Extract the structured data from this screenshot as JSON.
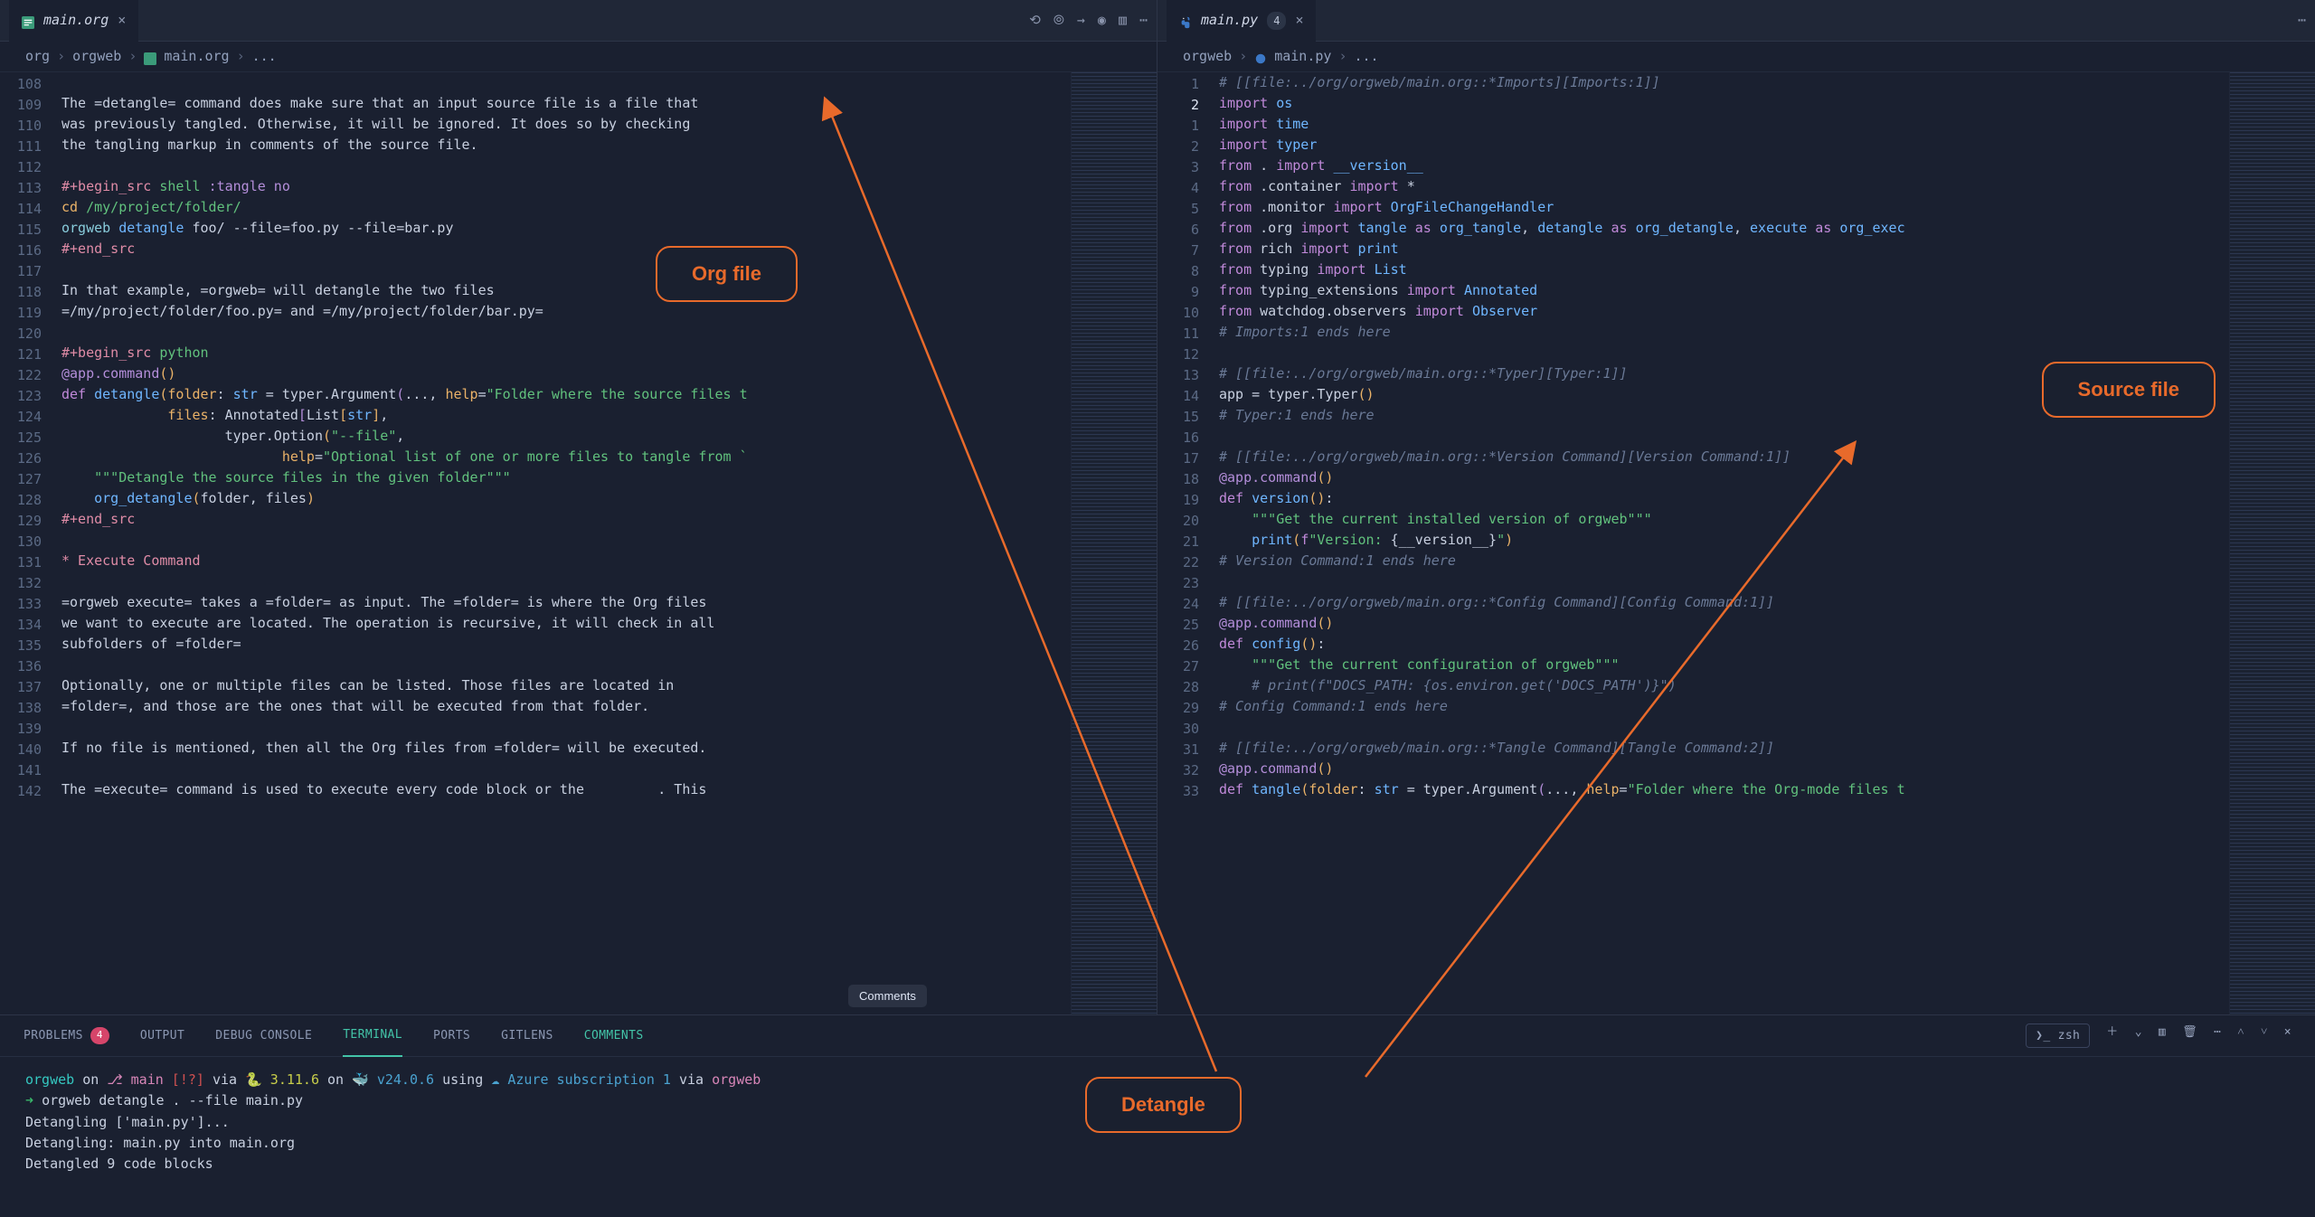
{
  "left": {
    "tabName": "main.org",
    "crumbs": [
      "org",
      "orgweb",
      "main.org",
      "..."
    ],
    "start": 108,
    "code": [
      "",
      "The =detangle= command does make sure that an input source file is a file that",
      "was previously tangled. Otherwise, it will be ignored. It does so by checking",
      "the tangling markup in comments of the source file.",
      "",
      "<dr>#+begin_src</dr> <st>shell</st> <hl>:tangle no</hl>",
      "<yl>cd</yl> <st>/my/project/folder/</st>",
      "<op>orgweb</op> <fn>detangle</fn> foo/ --file=foo.py --file=bar.py",
      "<dr>#+end_src</dr>",
      "",
      "In that example, =orgweb= will detangle the two files",
      "=/my/project/folder/foo.py= and =/my/project/folder/bar.py=",
      "",
      "<dr>#+begin_src</dr> <st>python</st>",
      "<hl>@app.command</hl><yl>()</yl>",
      "<kw>def</kw> <fn>detangle</fn><yl>(</yl><nm>folder</nm>: <fn>str</fn> = typer.Argument<hl>(</hl>..., <nm>help</nm>=<st>\"Folder where the source files t</st>",
      "             <nm>files</nm>: Annotated<hl>[</hl>List<yl>[</yl><fn>str</fn><yl>]</yl>,",
      "                    typer.Option<yl>(</yl><st>\"--file\"</st>,",
      "                           <nm>help</nm>=<st>\"Optional list of one or more files to tangle from `</st>",
      "    <st>\"\"\"Detangle the source files in the given folder\"\"\"</st>",
      "    <fn>org_detangle</fn><yl>(</yl>folder, files<yl>)</yl>",
      "<dr>#+end_src</dr>",
      "",
      "<dr>* Execute Command</dr>",
      "",
      "=orgweb execute= takes a =folder= as input. The =folder= is where the Org files",
      "we want to execute are located. The operation is recursive, it will check in all",
      "subfolders of =folder=",
      "",
      "Optionally, one or multiple files can be listed. Those files are located in",
      "=folder=, and those are the ones that will be executed from that folder.",
      "",
      "If no file is mentioned, then all the Org files from =folder= will be executed.",
      "",
      "The =execute= command is used to execute every code block or the         . This"
    ]
  },
  "right": {
    "tabName": "main.py",
    "tabBadge": "4",
    "crumbs": [
      "orgweb",
      "main.py",
      "..."
    ],
    "lineNumbers": [
      1,
      2,
      1,
      2,
      3,
      4,
      5,
      6,
      7,
      8,
      9,
      10,
      11,
      12,
      13,
      14,
      15,
      16,
      17,
      18,
      19,
      20,
      21,
      22,
      23,
      24,
      25,
      26,
      27,
      28,
      29,
      30,
      31,
      32,
      33
    ],
    "currentIdx": 1,
    "code": [
      "<cm># [[file:../org/orgweb/main.org::*Imports][Imports:1]]</cm>",
      "<kw>import</kw> <fn>os</fn>",
      "<kw>import</kw> <fn>time</fn>",
      "<kw>import</kw> <fn>typer</fn>",
      "<kw>from</kw> . <kw>import</kw> <fn>__version__</fn>",
      "<kw>from</kw> .container <kw>import</kw> *",
      "<kw>from</kw> .monitor <kw>import</kw> <fn>OrgFileChangeHandler</fn>",
      "<kw>from</kw> .org <kw>import</kw> <fn>tangle</fn> <kw>as</kw> <fn>org_tangle</fn>, <fn>detangle</fn> <kw>as</kw> <fn>org_detangle</fn>, <fn>execute</fn> <kw>as</kw> <fn>org_exec</fn>",
      "<kw>from</kw> rich <kw>import</kw> <fn>print</fn>",
      "<kw>from</kw> typing <kw>import</kw> <fn>List</fn>",
      "<kw>from</kw> typing_extensions <kw>import</kw> <fn>Annotated</fn>",
      "<kw>from</kw> watchdog.observers <kw>import</kw> <fn>Observer</fn>",
      "<cm># Imports:1 ends here</cm>",
      "",
      "<cm># [[file:../org/orgweb/main.org::*Typer][Typer:1]]</cm>",
      "app = typer.Typer<yl>()</yl>",
      "<cm># Typer:1 ends here</cm>",
      "",
      "<cm># [[file:../org/orgweb/main.org::*Version Command][Version Command:1]]</cm>",
      "<hl>@app.command</hl><yl>()</yl>",
      "<kw>def</kw> <fn>version</fn><yl>()</yl>:",
      "    <st>\"\"\"Get the current installed version of orgweb\"\"\"</st>",
      "    <fn>print</fn><yl>(</yl><kw>f</kw><st>\"Version: </st>{__version__}<st>\"</st><yl>)</yl>",
      "<cm># Version Command:1 ends here</cm>",
      "",
      "<cm># [[file:../org/orgweb/main.org::*Config Command][Config Command:1]]</cm>",
      "<hl>@app.command</hl><yl>()</yl>",
      "<kw>def</kw> <fn>config</fn><yl>()</yl>:",
      "    <st>\"\"\"Get the current configuration of orgweb\"\"\"</st>",
      "    <cm># print(f\"DOCS_PATH: {os.environ.get('DOCS_PATH')}\")</cm>",
      "<cm># Config Command:1 ends here</cm>",
      "",
      "<cm># [[file:../org/orgweb/main.org::*Tangle Command][Tangle Command:2]]</cm>",
      "<hl>@app.command</hl><yl>()</yl>",
      "<kw>def</kw> <fn>tangle</fn><yl>(</yl><nm>folder</nm>: <fn>str</fn> = typer.Argument<hl>(</hl>..., <nm>help</nm>=<st>\"Folder where the Org-mode files t</st>"
    ]
  },
  "panel": {
    "tabs": [
      "PROBLEMS",
      "OUTPUT",
      "DEBUG CONSOLE",
      "TERMINAL",
      "PORTS",
      "GITLENS",
      "COMMENTS"
    ],
    "problemBadge": "4",
    "shell": "zsh",
    "term": {
      "promptParts": {
        "p1": "orgweb",
        "p2": "on",
        "p3": "main",
        "p4": "[!?]",
        "p5": "via",
        "p6": "3.11.6",
        "p7": "on",
        "p8": "v24.0.6",
        "p9": "using",
        "p10": "Azure subscription 1",
        "p11": "via",
        "p12": "orgweb"
      },
      "cmd": "orgweb detangle . --file main.py",
      "out1": "Detangling ['main.py']...",
      "out2": "Detangling: main.py into main.org",
      "out3": "Detangled 9 code blocks"
    }
  },
  "annots": {
    "org": "Org file",
    "source": "Source file",
    "detangle": "Detangle"
  },
  "tooltip": "Comments"
}
